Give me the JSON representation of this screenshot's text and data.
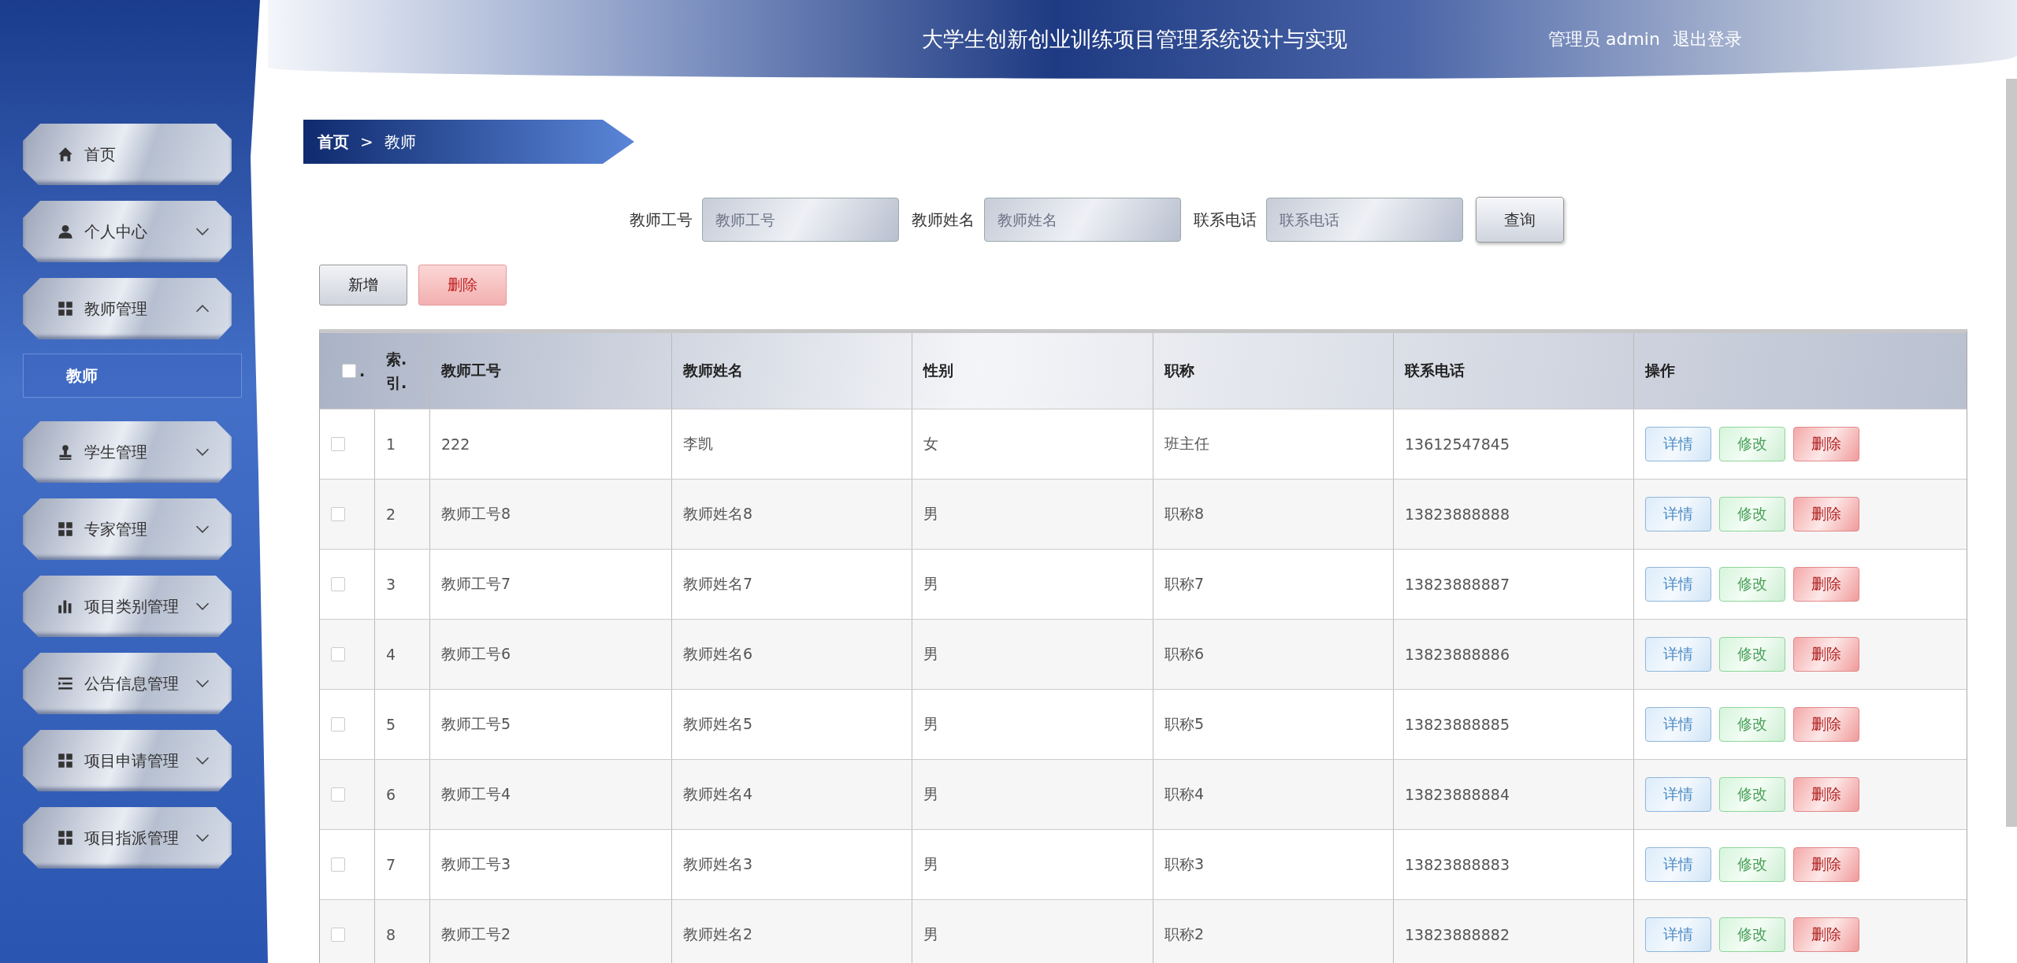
{
  "header": {
    "title": "大学生创新创业训练项目管理系统设计与实现",
    "user": "管理员 admin",
    "logout": "退出登录"
  },
  "sidebar": {
    "items": [
      {
        "label": "首页",
        "kind": "link"
      },
      {
        "label": "个人中心",
        "kind": "menu",
        "expanded": false
      },
      {
        "label": "教师管理",
        "kind": "menu",
        "expanded": true,
        "children": [
          {
            "label": "教师",
            "selected": true
          }
        ]
      },
      {
        "label": "学生管理",
        "kind": "menu",
        "expanded": false
      },
      {
        "label": "专家管理",
        "kind": "menu",
        "expanded": false
      },
      {
        "label": "项目类别管理",
        "kind": "menu",
        "expanded": false
      },
      {
        "label": "公告信息管理",
        "kind": "menu",
        "expanded": false
      },
      {
        "label": "项目申请管理",
        "kind": "menu",
        "expanded": false
      },
      {
        "label": "项目指派管理",
        "kind": "menu",
        "expanded": false
      }
    ]
  },
  "breadcrumb": {
    "home": "首页",
    "separator": ">",
    "current": "教师"
  },
  "search": {
    "fields": [
      {
        "label": "教师工号",
        "placeholder": "教师工号"
      },
      {
        "label": "教师姓名",
        "placeholder": "教师姓名"
      },
      {
        "label": "联系电话",
        "placeholder": "联系电话"
      }
    ],
    "button": "查询"
  },
  "actions": [
    {
      "label": "新增",
      "kind": "default"
    },
    {
      "label": "删除",
      "kind": "danger"
    }
  ],
  "table": {
    "header_checked": false,
    "select_label": ".",
    "columns": [
      "索.引.",
      "教师工号",
      "教师姓名",
      "性别",
      "职称",
      "联系电话",
      "操作"
    ],
    "rows": [
      {
        "checked": false,
        "cells": [
          "1",
          "222",
          "李凯",
          "女",
          "班主任",
          "13612547845"
        ],
        "buttons": [
          "详情",
          "修改",
          "删除"
        ]
      },
      {
        "checked": false,
        "cells": [
          "2",
          "教师工号8",
          "教师姓名8",
          "男",
          "职称8",
          "13823888888"
        ],
        "buttons": [
          "详情",
          "修改",
          "删除"
        ]
      },
      {
        "checked": false,
        "cells": [
          "3",
          "教师工号7",
          "教师姓名7",
          "男",
          "职称7",
          "13823888887"
        ],
        "buttons": [
          "详情",
          "修改",
          "删除"
        ]
      },
      {
        "checked": false,
        "cells": [
          "4",
          "教师工号6",
          "教师姓名6",
          "男",
          "职称6",
          "13823888886"
        ],
        "buttons": [
          "详情",
          "修改",
          "删除"
        ]
      },
      {
        "checked": false,
        "cells": [
          "5",
          "教师工号5",
          "教师姓名5",
          "男",
          "职称5",
          "13823888885"
        ],
        "buttons": [
          "详情",
          "修改",
          "删除"
        ]
      },
      {
        "checked": false,
        "cells": [
          "6",
          "教师工号4",
          "教师姓名4",
          "男",
          "职称4",
          "13823888884"
        ],
        "buttons": [
          "详情",
          "修改",
          "删除"
        ]
      },
      {
        "checked": false,
        "cells": [
          "7",
          "教师工号3",
          "教师姓名3",
          "男",
          "职称3",
          "13823888883"
        ],
        "buttons": [
          "详情",
          "修改",
          "删除"
        ]
      },
      {
        "checked": false,
        "cells": [
          "8",
          "教师工号2",
          "教师姓名2",
          "男",
          "职称2",
          "13823888882"
        ],
        "buttons": [
          "详情",
          "修改",
          "删除"
        ]
      }
    ]
  }
}
